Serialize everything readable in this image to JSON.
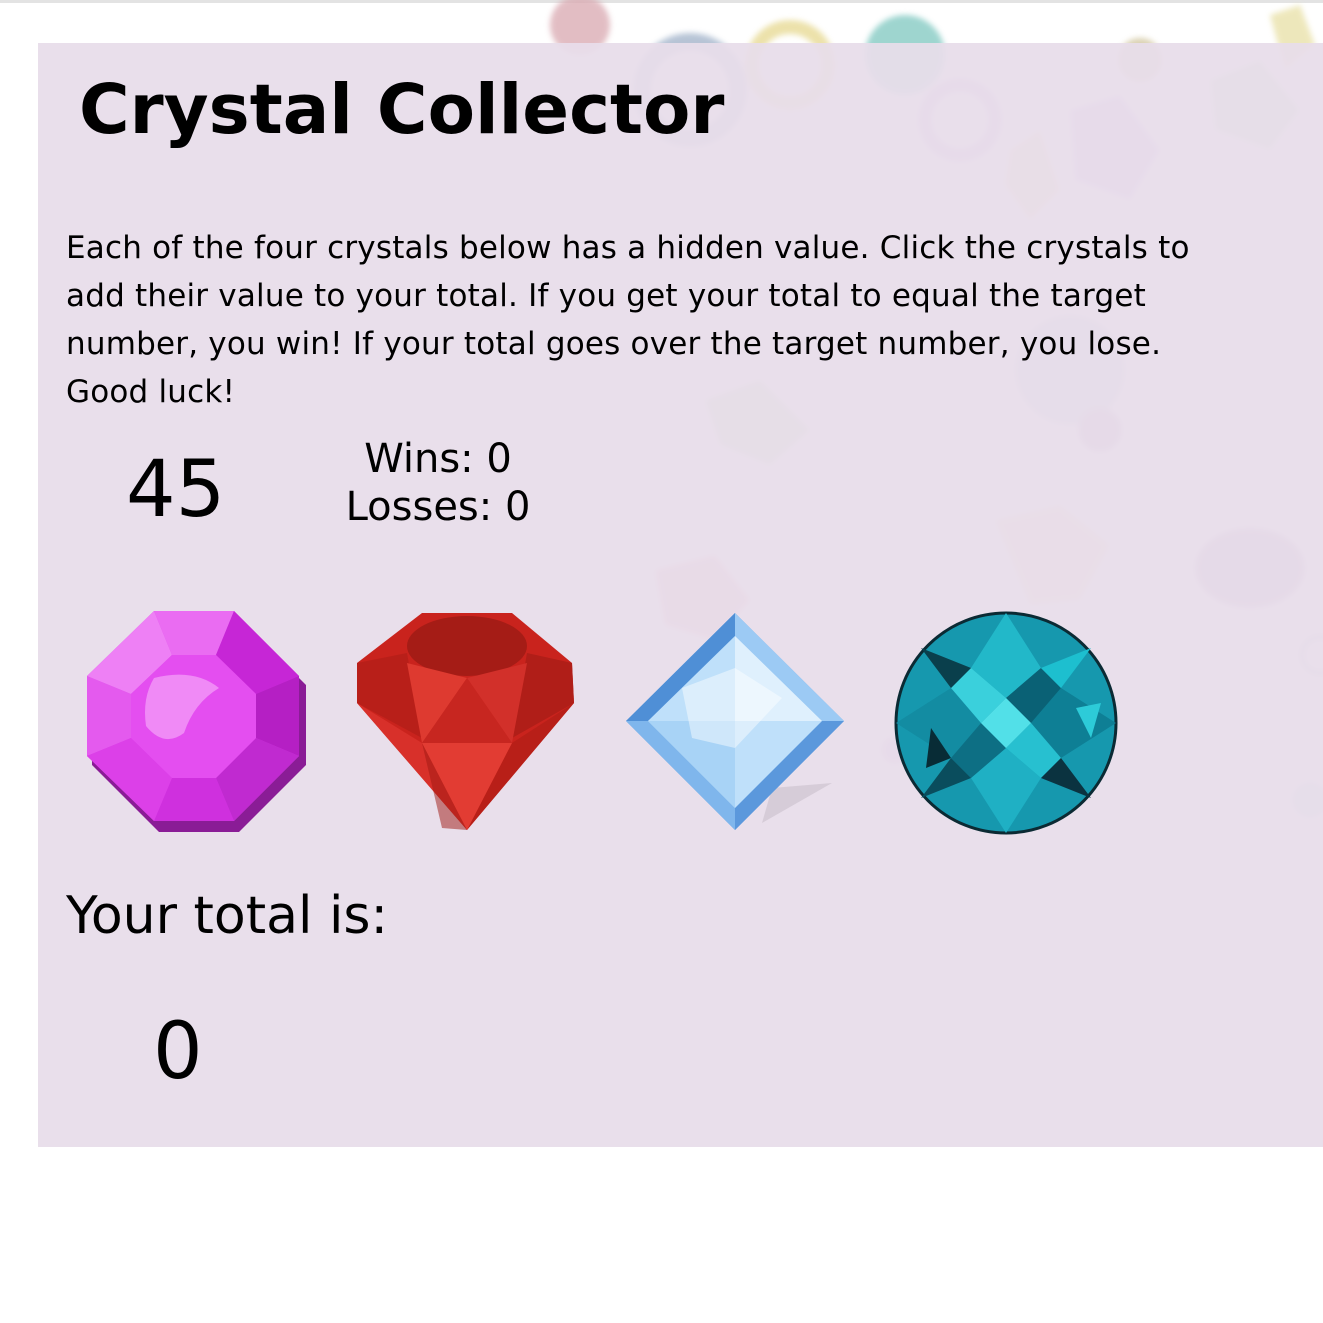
{
  "game": {
    "title": "Crystal Collector",
    "instructions": "Each of the four crystals below has a hidden value. Click the crystals to add their value to your total. If you get your total to equal the target number, you win! If your total goes over the target number, you lose. Good luck!",
    "target_number": "45",
    "wins_text": "Wins: 0",
    "losses_text": "Losses: 0",
    "total_label": "Your total is:",
    "total_value": "0"
  },
  "crystals": [
    {
      "name": "purple-octagon-crystal-icon",
      "color": "#d633e0"
    },
    {
      "name": "red-ruby-crystal-icon",
      "color": "#d42a22"
    },
    {
      "name": "blue-diamond-crystal-icon",
      "color": "#8cc8f5"
    },
    {
      "name": "teal-round-crystal-icon",
      "color": "#18a3b8"
    }
  ],
  "colors": {
    "panel_background": "#e8ddea",
    "page_background": "#ffffff"
  }
}
